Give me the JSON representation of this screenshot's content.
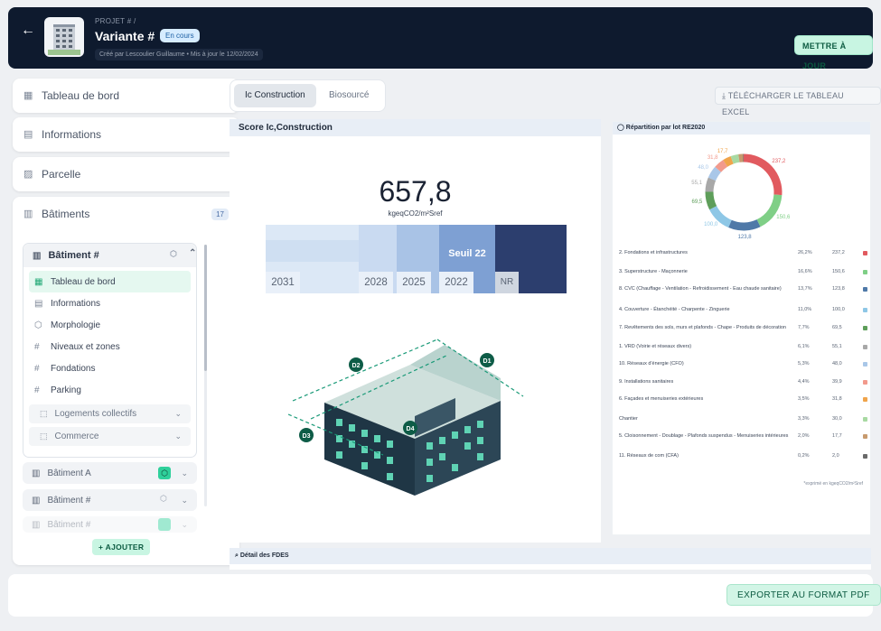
{
  "header": {
    "back_icon": "arrow-left-icon",
    "breadcrumb": "PROJET #  /",
    "title": "Variante #",
    "status": "En cours",
    "meta": "Créé par Lescoulier Guillaume • Mis à jour le 12/02/2024",
    "update_label": "METTRE À JOUR"
  },
  "sidebar": {
    "items": [
      {
        "label": "Tableau de bord",
        "icon": "dashboard-icon"
      },
      {
        "label": "Informations",
        "icon": "info-card-icon"
      },
      {
        "label": "Parcelle",
        "icon": "parcel-hatch-icon"
      },
      {
        "label": "Bâtiments",
        "icon": "building-icon",
        "count": "17"
      }
    ],
    "building": {
      "name": "Bâtiment #",
      "subitems": [
        {
          "label": "Tableau de bord",
          "icon": "dashboard-icon"
        },
        {
          "label": "Informations",
          "icon": "info-card-icon"
        },
        {
          "label": "Morphologie",
          "icon": "cube-icon"
        },
        {
          "label": "Niveaux et zones",
          "icon": "grid-icon"
        },
        {
          "label": "Fondations",
          "icon": "grid-icon"
        },
        {
          "label": "Parking",
          "icon": "grid-icon"
        }
      ],
      "groups": [
        "Logements collectifs",
        "Commerce"
      ]
    },
    "collapsed": [
      {
        "label": "Bâtiment A"
      },
      {
        "label": "Bâtiment #"
      },
      {
        "label": "Bâtiment #"
      }
    ],
    "add_label": "AJOUTER"
  },
  "tabs": [
    "Ic Construction",
    "Biosourcé"
  ],
  "download_label": "TÉLÉCHARGER LE TABLEAU EXCEL",
  "score": {
    "title": "Score Ic,Construction",
    "value": "657,8",
    "unit": "kgeqCO2/m²Sref",
    "threshold_label": "Seuil 22",
    "years": [
      "2031",
      "2028",
      "2025",
      "2022",
      "NR"
    ],
    "facade_labels": [
      "D1",
      "D2",
      "D3",
      "D4"
    ]
  },
  "repartition": {
    "title": "Répartition par lot RE2020",
    "donut_labels": [
      "237,2",
      "150,6",
      "123,8",
      "100,0",
      "69,5",
      "55,1",
      "48,0",
      "31,8",
      "17,7"
    ],
    "rows": [
      {
        "label": "2. Fondations et infrastructures",
        "pct": "26,2%",
        "val": "237,2",
        "color": "#e15a5f"
      },
      {
        "label": "3. Superstructure - Maçonnerie",
        "pct": "16,6%",
        "val": "150,6",
        "color": "#7fcf86"
      },
      {
        "label": "8. CVC (Chauffage - Ventilation - Refroidissement - Eau chaude sanitaire)",
        "pct": "13,7%",
        "val": "123,8",
        "color": "#4f79a8"
      },
      {
        "label": "4. Couverture - Étanchéité - Charpente - Zinguerie",
        "pct": "11,0%",
        "val": "100,0",
        "color": "#8ec7e6"
      },
      {
        "label": "7. Revêtements des sols, murs et plafonds - Chape - Produits de décoration",
        "pct": "7,7%",
        "val": "69,5",
        "color": "#5e9e5a"
      },
      {
        "label": "1. VRD (Voirie et réseaux divers)",
        "pct": "6,1%",
        "val": "55,1",
        "color": "#a8a8a8"
      },
      {
        "label": "10. Réseaux d'énergie (CFO)",
        "pct": "5,3%",
        "val": "48,0",
        "color": "#a9c7e8"
      },
      {
        "label": "9. Installations sanitaires",
        "pct": "4,4%",
        "val": "39,9",
        "color": "#f29a8c"
      },
      {
        "label": "6. Façades et menuiseries extérieures",
        "pct": "3,5%",
        "val": "31,8",
        "color": "#f0a44b"
      },
      {
        "label": "Chantier",
        "pct": "3,3%",
        "val": "30,0",
        "color": "#a8d9a2"
      },
      {
        "label": "5. Cloisonnement - Doublage - Plafonds suspendus - Menuiseries intérieures",
        "pct": "2,0%",
        "val": "17,7",
        "color": "#c79a6e"
      },
      {
        "label": "11. Réseaux de com (CFA)",
        "pct": "0,2%",
        "val": "2,0",
        "color": "#6a6a6a"
      }
    ],
    "note": "*exprimé en kgeqCO2/m²Sref"
  },
  "fdes_title": "Détail des FDES",
  "export_label": "EXPORTER AU FORMAT PDF"
}
